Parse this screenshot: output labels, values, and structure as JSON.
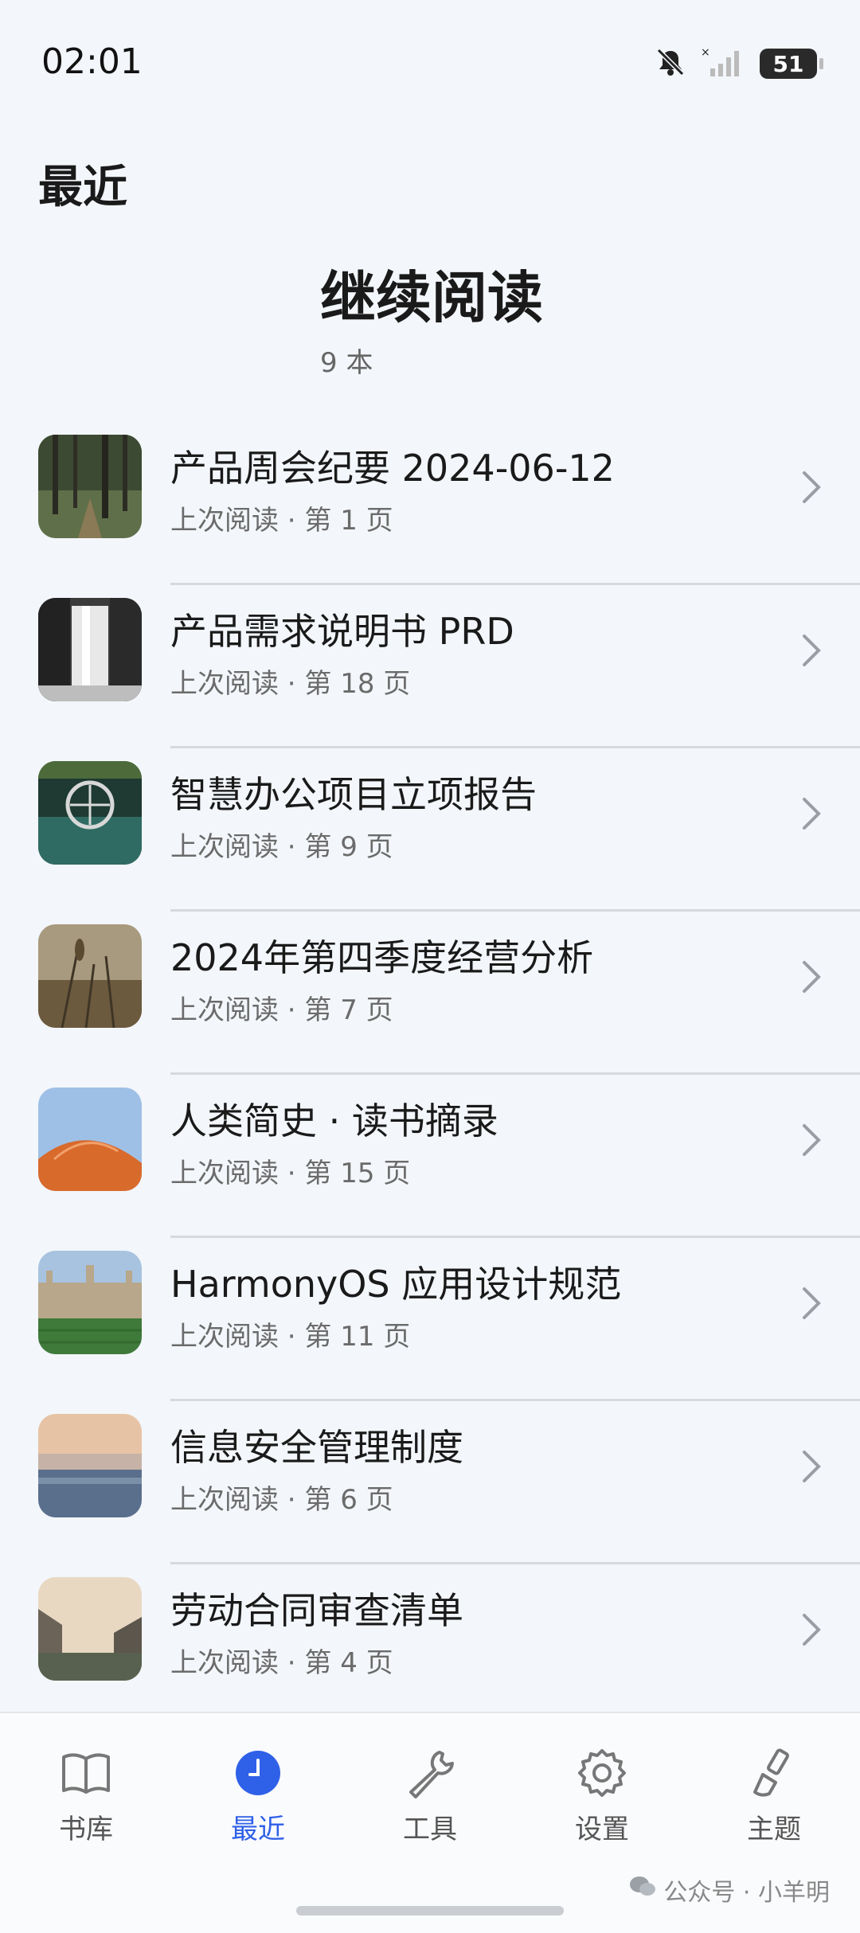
{
  "status_bar": {
    "time": "02:01",
    "battery": "51"
  },
  "page_title": "最近",
  "section": {
    "title": "继续阅读",
    "count": "9 本"
  },
  "items": [
    {
      "title": "产品周会纪要 2024-06-12",
      "sub": "上次阅读 · 第 1 页"
    },
    {
      "title": "产品需求说明书 PRD",
      "sub": "上次阅读 · 第 18 页"
    },
    {
      "title": "智慧办公项目立项报告",
      "sub": "上次阅读 · 第 9 页"
    },
    {
      "title": "2024年第四季度经营分析",
      "sub": "上次阅读 · 第 7 页"
    },
    {
      "title": "人类简史 · 读书摘录",
      "sub": "上次阅读 · 第 15 页"
    },
    {
      "title": "HarmonyOS 应用设计规范",
      "sub": "上次阅读 · 第 11 页"
    },
    {
      "title": "信息安全管理制度",
      "sub": "上次阅读 · 第 6 页"
    },
    {
      "title": "劳动合同审查清单",
      "sub": "上次阅读 · 第 4 页"
    }
  ],
  "nav": {
    "library": "书库",
    "recent": "最近",
    "tools": "工具",
    "settings": "设置",
    "theme": "主题"
  },
  "watermark": "公众号 · 小羊明",
  "colors": {
    "accent": "#2f60e8",
    "background": "#f3f6fa"
  }
}
